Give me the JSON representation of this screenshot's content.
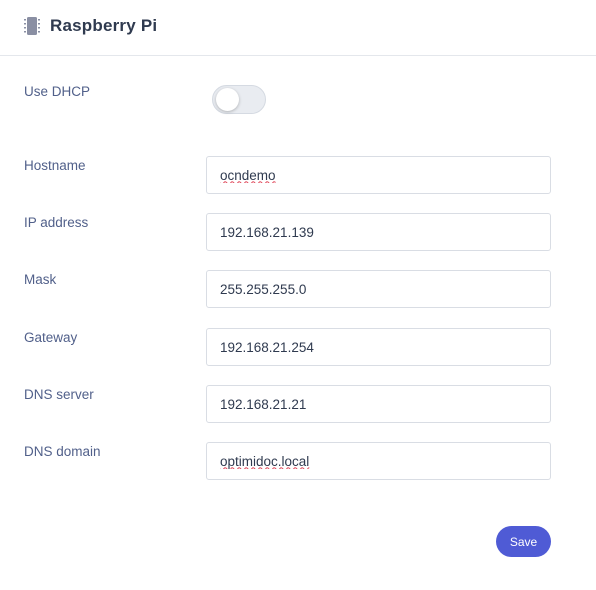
{
  "header": {
    "title": "Raspberry Pi",
    "icon": "chip-icon"
  },
  "form": {
    "dhcp": {
      "label": "Use DHCP",
      "enabled": false
    },
    "fields": [
      {
        "key": "hostname",
        "label": "Hostname",
        "value": "ocndemo"
      },
      {
        "key": "ip",
        "label": "IP address",
        "value": "192.168.21.139"
      },
      {
        "key": "mask",
        "label": "Mask",
        "value": "255.255.255.0"
      },
      {
        "key": "gateway",
        "label": "Gateway",
        "value": "192.168.21.254"
      },
      {
        "key": "dns-server",
        "label": "DNS server",
        "value": "192.168.21.21"
      },
      {
        "key": "dns-domain",
        "label": "DNS domain",
        "value": "optimidoc.local"
      }
    ],
    "save_label": "Save"
  },
  "colors": {
    "accent": "#4f5bd5",
    "label": "#51608a",
    "border": "#d9dde4"
  }
}
